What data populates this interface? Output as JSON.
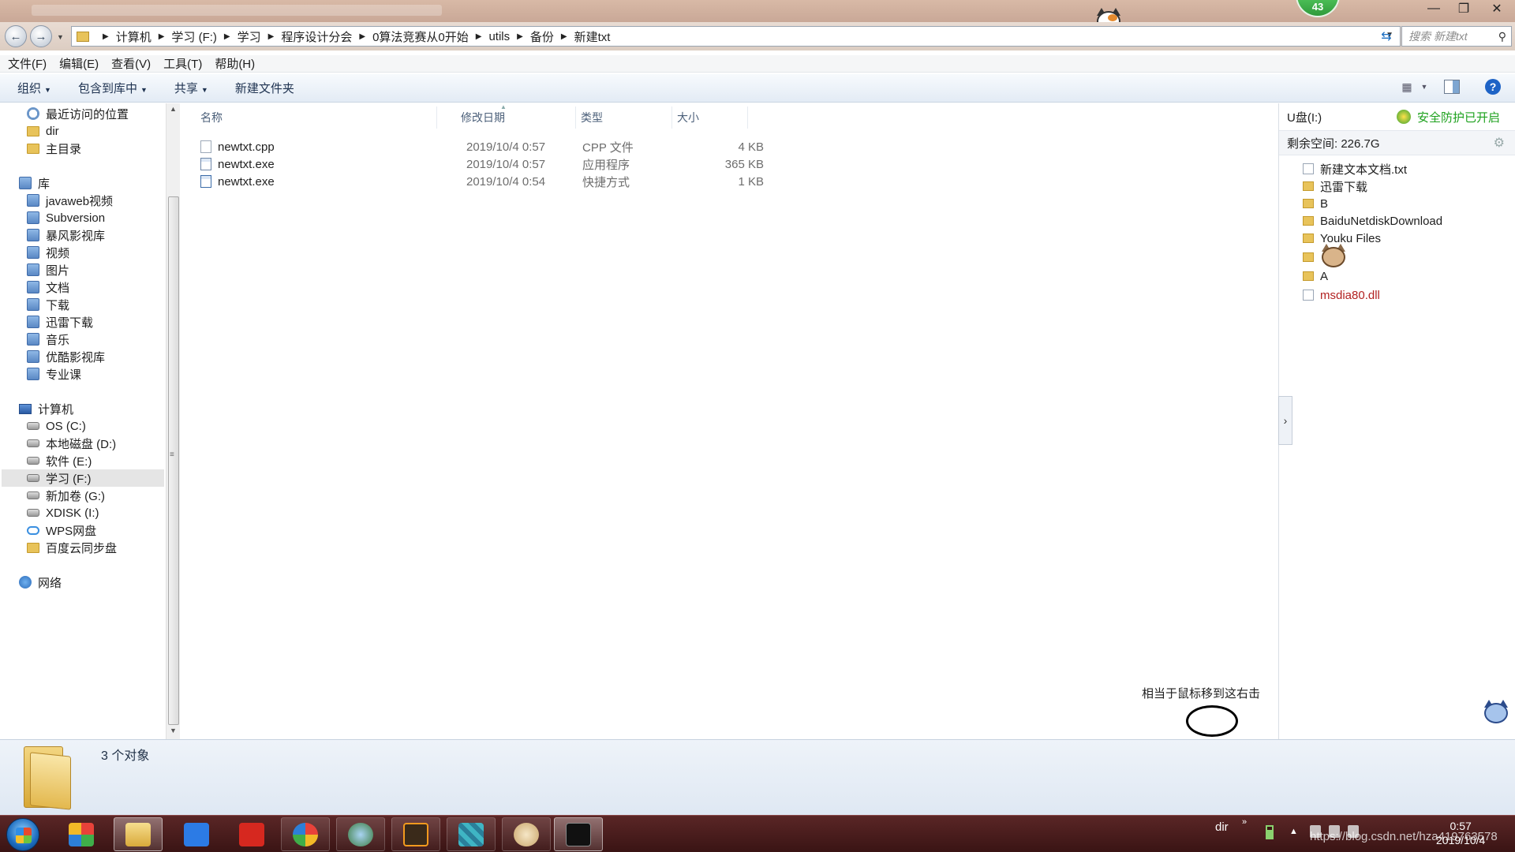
{
  "window": {
    "badge": "43",
    "controls": {
      "minimize": "—",
      "maximize": "❐",
      "close": "✕"
    }
  },
  "address": {
    "crumbs": [
      "计算机",
      "学习 (F:)",
      "学习",
      "程序设计分会",
      "0算法竞赛从0开始",
      "utils",
      "备份",
      "新建txt"
    ],
    "search_placeholder": "搜索 新建txt"
  },
  "menu": [
    "文件(F)",
    "编辑(E)",
    "查看(V)",
    "工具(T)",
    "帮助(H)"
  ],
  "toolbar": {
    "organize": "组织",
    "include_library": "包含到库中",
    "share": "共享",
    "new_folder": "新建文件夹"
  },
  "nav": {
    "favorites": [
      {
        "label": "最近访问的位置",
        "icon": "recent-places-icon"
      },
      {
        "label": "dir",
        "icon": "folder-icon"
      },
      {
        "label": "主目录",
        "icon": "folder-icon"
      }
    ],
    "libraries_label": "库",
    "libraries": [
      {
        "label": "javaweb视频"
      },
      {
        "label": "Subversion"
      },
      {
        "label": "暴风影视库"
      },
      {
        "label": "视频"
      },
      {
        "label": "图片"
      },
      {
        "label": "文档"
      },
      {
        "label": "下载"
      },
      {
        "label": "迅雷下载"
      },
      {
        "label": "音乐"
      },
      {
        "label": "优酷影视库"
      },
      {
        "label": "专业课"
      }
    ],
    "computer_label": "计算机",
    "drives": [
      {
        "label": "OS (C:)"
      },
      {
        "label": "本地磁盘 (D:)"
      },
      {
        "label": "软件 (E:)"
      },
      {
        "label": "学习 (F:)",
        "selected": true
      },
      {
        "label": "新加卷 (G:)"
      },
      {
        "label": "XDISK (I:)"
      },
      {
        "label": "WPS网盘"
      },
      {
        "label": "百度云同步盘"
      }
    ],
    "network_label": "网络"
  },
  "columns": {
    "name": "名称",
    "modified": "修改日期",
    "type": "类型",
    "size": "大小"
  },
  "files": [
    {
      "name": "newtxt.cpp",
      "modified": "2019/10/4 0:57",
      "type": "CPP 文件",
      "size": "4 KB",
      "icon": "cpp-file-icon"
    },
    {
      "name": "newtxt.exe",
      "modified": "2019/10/4 0:57",
      "type": "应用程序",
      "size": "365 KB",
      "icon": "exe-file-icon"
    },
    {
      "name": "newtxt.exe",
      "modified": "2019/10/4 0:54",
      "type": "快捷方式",
      "size": "1 KB",
      "icon": "shortcut-file-icon"
    }
  ],
  "annotation": "相当于鼠标移到这右击",
  "rightpane": {
    "drive_label": "U盘(I:)",
    "security": "安全防护已开启",
    "free_space": "剩余空间: 226.7G",
    "items": [
      {
        "label": "新建文本文档.txt",
        "kind": "doc"
      },
      {
        "label": "迅雷下载",
        "kind": "folder"
      },
      {
        "label": "B",
        "kind": "folder"
      },
      {
        "label": "BaiduNetdiskDownload",
        "kind": "folder"
      },
      {
        "label": "Youku Files",
        "kind": "folder"
      },
      {
        "label": "",
        "kind": "folder"
      },
      {
        "label": "A",
        "kind": "folder"
      },
      {
        "label": "msdia80.dll",
        "kind": "dll"
      }
    ]
  },
  "details": {
    "count": "3 个对象"
  },
  "taskbar": {
    "tray_text": "dir",
    "tray_expand": "»",
    "time": "0:57",
    "date": "2019/10/4",
    "watermark": "https://blog.csdn.net/hza419763578"
  },
  "colors": {
    "accent": "#1e63c6",
    "security_green": "#1da11d",
    "taskbar": "#4a1c1c",
    "dll_red": "#b22222"
  }
}
